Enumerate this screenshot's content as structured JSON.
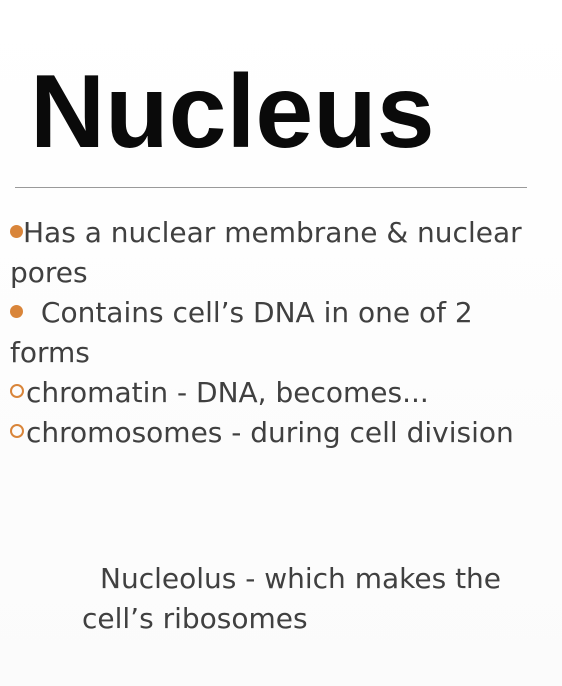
{
  "slide": {
    "title": "Nucleus",
    "bullets": [
      {
        "marker": "filled-dot",
        "text": "Has a nuclear membrane & nuclear pores"
      },
      {
        "marker": "filled-dot",
        "text": " Contains cell’s DNA in one of 2 forms"
      },
      {
        "marker": "hollow-circle",
        "text": "chromatin - DNA, becomes..."
      },
      {
        "marker": "hollow-circle",
        "text": "chromosomes - during cell division"
      }
    ],
    "note": "Nucleolus - which makes the cell’s ribosomes"
  },
  "colors": {
    "bullet_marker": "#d9853a",
    "body_text": "#404040",
    "title_text": "#0a0a0a",
    "divider": "#9a9a9a"
  },
  "icons": {
    "filled_marker": "filled-dot-bullet-icon",
    "hollow_marker": "hollow-circle-bullet-icon"
  }
}
